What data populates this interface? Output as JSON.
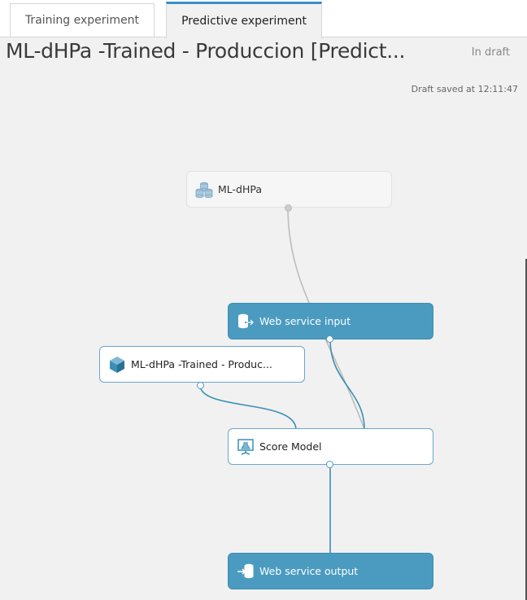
{
  "tabs": [
    {
      "label": "Training experiment",
      "active": false
    },
    {
      "label": "Predictive experiment",
      "active": true
    }
  ],
  "experiment": {
    "title": "ML-dHPa -Trained - Produccion [Predict...",
    "status": "In draft",
    "saved": "Draft saved at 12:11:47"
  },
  "nodes": {
    "dataset": {
      "label": "ML-dHPa",
      "icon": "dataset-icon"
    },
    "web_input": {
      "label": "Web service input",
      "icon": "web-service-input-icon"
    },
    "trained_model": {
      "label": "ML-dHPa -Trained - Produc...",
      "icon": "trained-model-icon"
    },
    "score_model": {
      "label": "Score Model",
      "icon": "score-model-icon"
    },
    "web_output": {
      "label": "Web service output",
      "icon": "web-service-output-icon"
    }
  },
  "colors": {
    "accent": "#4b9bc0",
    "connector": "#3a8fb7",
    "inactive_connector": "#bdbdbd"
  }
}
